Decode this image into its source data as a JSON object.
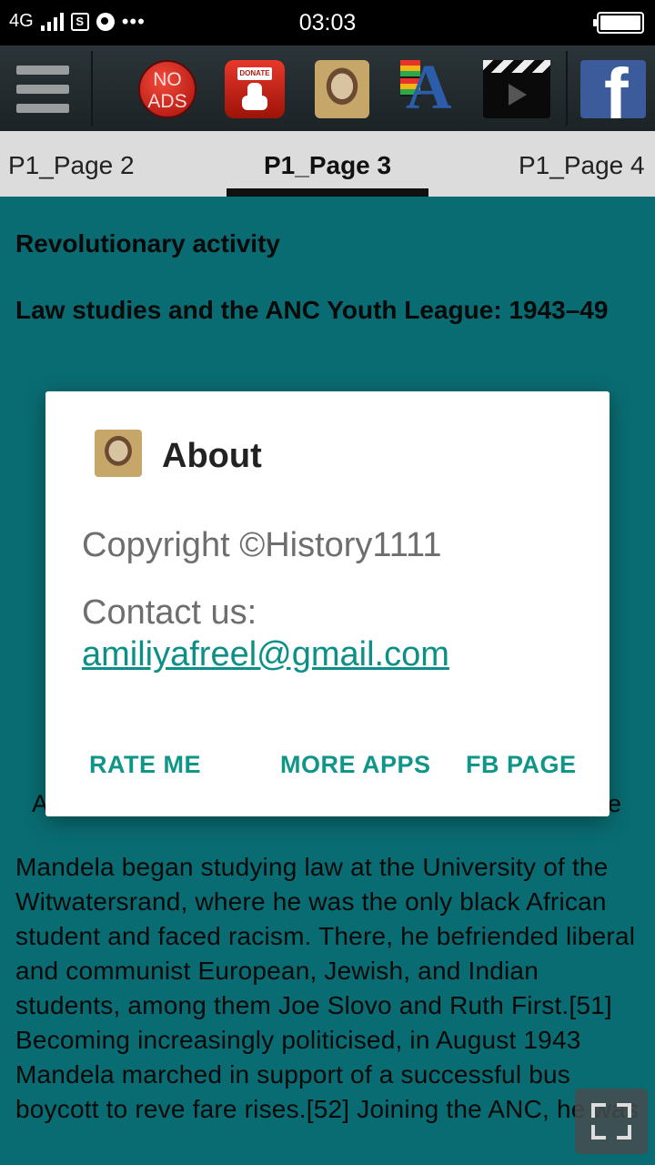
{
  "status_bar": {
    "network": "4G",
    "sim_badge": "S",
    "overflow": "•••",
    "time": "03:03",
    "battery_level": 1.0
  },
  "toolbar": {
    "icons": [
      "menu-icon",
      "no-ads-icon",
      "donate-icon",
      "mandela-portrait-icon",
      "font-app-icon",
      "video-clapper-icon",
      "facebook-icon"
    ],
    "no_ads_line1": "NO",
    "no_ads_line2": "ADS",
    "donate_tag": "DONATE",
    "font_letter": "A",
    "facebook_letter": "f"
  },
  "tabs": [
    {
      "label": "P1_Page 2",
      "selected": false
    },
    {
      "label": "P1_Page 3",
      "selected": true
    },
    {
      "label": "P1_Page 4",
      "selected": false
    }
  ],
  "article": {
    "heading": "Revolutionary activity",
    "subheading": "Law studies and the ANC Youth League: 1943–49",
    "caption_left": "A",
    "caption_right": "e",
    "body": "Mandela began studying law at the University of the Witwatersrand, where he was the only black African student and faced racism. There, he befriended liberal and communist European, Jewish, and Indian students, among them Joe Slovo and Ruth First.[51] Becoming increasingly politicised, in August 1943 Mandela marched in support of a successful bus boycott to reve fare rises.[52] Joining the ANC, he was"
  },
  "dialog": {
    "title": "About",
    "copyright": "Copyright ©History1111",
    "contact_label": "Contact us:",
    "email": "amiliyafreel@gmail.com",
    "buttons": {
      "rate": "RATE ME",
      "more_apps": "MORE APPS",
      "fb_page": "FB PAGE"
    }
  },
  "colors": {
    "background": "#0b7f87",
    "accent": "#0f9688",
    "toolbar": "#1c2326"
  }
}
